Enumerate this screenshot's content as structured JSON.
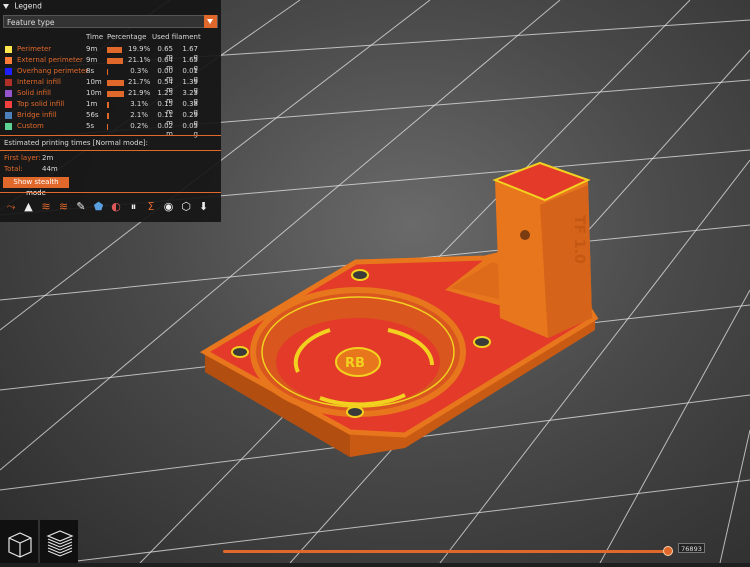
{
  "legend": {
    "title": "Legend",
    "dropdown_value": "Feature type",
    "headers": {
      "time": "Time",
      "percentage": "Percentage",
      "used_filament": "Used filament"
    },
    "rows": [
      {
        "name": "Perimeter",
        "color": "#ffe64d",
        "time": "9m",
        "percent": "19.9%",
        "pct_value": 19.9,
        "meters": "0.65 m",
        "grams": "1.67 g"
      },
      {
        "name": "External perimeter",
        "color": "#ff7d38",
        "time": "9m",
        "percent": "21.1%",
        "pct_value": 21.1,
        "meters": "0.64 m",
        "grams": "1.65 g"
      },
      {
        "name": "Overhang perimeter",
        "color": "#1f1fff",
        "time": "8s",
        "percent": "0.3%",
        "pct_value": 0.3,
        "meters": "0.00 m",
        "grams": "0.01 g"
      },
      {
        "name": "Internal infill",
        "color": "#b03029",
        "time": "10m",
        "percent": "21.7%",
        "pct_value": 21.7,
        "meters": "0.54 m",
        "grams": "1.39 g"
      },
      {
        "name": "Solid infill",
        "color": "#9654cc",
        "time": "10m",
        "percent": "21.9%",
        "pct_value": 21.9,
        "meters": "1.25 m",
        "grams": "3.23 g"
      },
      {
        "name": "Top solid infill",
        "color": "#f04040",
        "time": "1m",
        "percent": "3.1%",
        "pct_value": 3.1,
        "meters": "0.15 m",
        "grams": "0.38 g"
      },
      {
        "name": "Bridge infill",
        "color": "#4d80ba",
        "time": "56s",
        "percent": "2.1%",
        "pct_value": 2.1,
        "meters": "0.11 m",
        "grams": "0.29 g"
      },
      {
        "name": "Custom",
        "color": "#5ed194",
        "time": "5s",
        "percent": "0.2%",
        "pct_value": 0.2,
        "meters": "0.02 m",
        "grams": "0.05 g"
      }
    ],
    "estimated_title": "Estimated printing times [Normal mode]:",
    "first_layer_label": "First layer:",
    "first_layer_value": "2m",
    "total_label": "Total:",
    "total_value": "44m",
    "stealth_button": "Show stealth mode",
    "toolbar_icons": [
      "travel-icon",
      "wipe-icon",
      "retractions-icon",
      "deretractions-icon",
      "seams-icon",
      "tool-changes-icon",
      "color-changes-icon",
      "pause-icon",
      "custom-gcode-icon",
      "center-of-gravity-icon",
      "shells-icon",
      "tool-marker-icon"
    ]
  },
  "model_text": {
    "version": "TF 1.0",
    "logo": "RB"
  },
  "colors": {
    "accent": "#e0682a",
    "model": "#e8761c",
    "top_surface": "#e33a2a",
    "perimeter": "#f2d11f"
  },
  "slider": {
    "value": "76893",
    "position_fraction": 1.0
  },
  "view_buttons": [
    "iso-view-icon",
    "layers-view-icon"
  ]
}
